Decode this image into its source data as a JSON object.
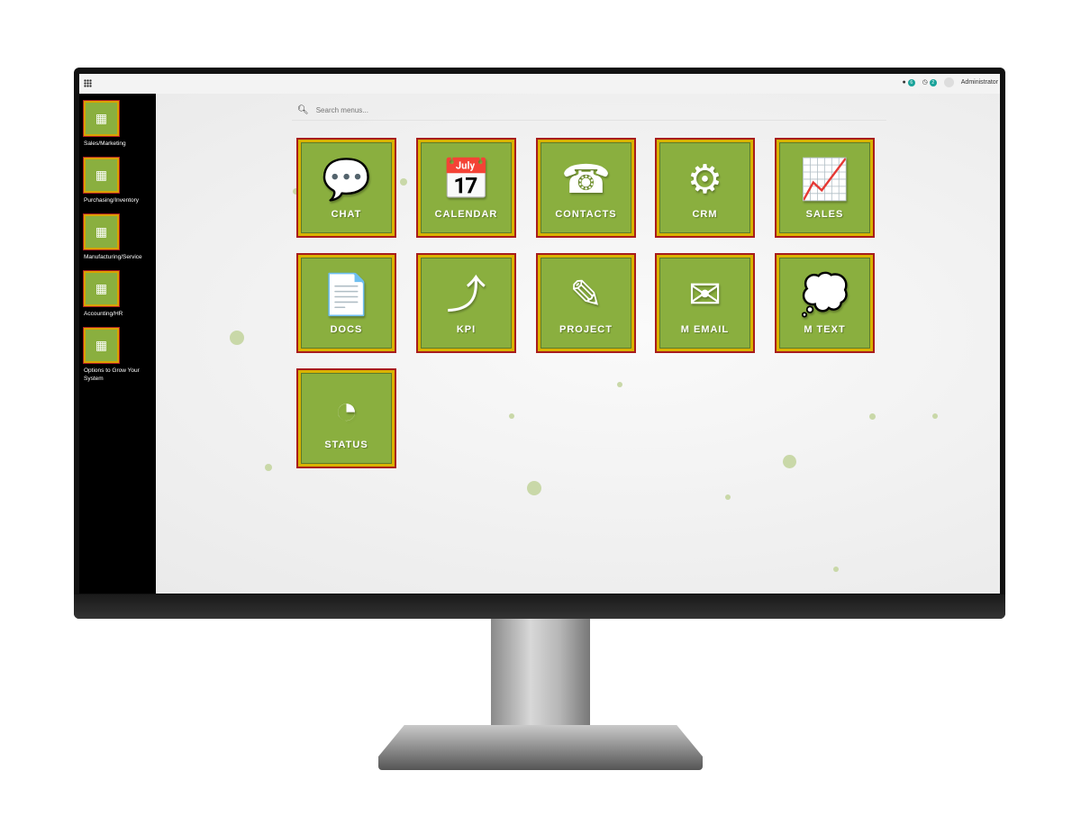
{
  "topbar": {
    "apps_icon": "grid-icon",
    "notif_count": "6",
    "activity_count": "2",
    "user": "Administrator"
  },
  "search": {
    "placeholder": "Search menus..."
  },
  "sidebar": {
    "items": [
      {
        "label": "Sales/Marketing",
        "icon": "chart-icon"
      },
      {
        "label": "Purchasing/Inventory",
        "icon": "clipboard-icon"
      },
      {
        "label": "Manufacturing/Service",
        "icon": "gear-hands-icon"
      },
      {
        "label": "Accounting/HR",
        "icon": "org-chart-icon"
      },
      {
        "label": "Options to Grow Your System",
        "icon": "plugin-icon"
      }
    ]
  },
  "tiles": [
    {
      "label": "CHAT",
      "glyph": "💬"
    },
    {
      "label": "CALENDAR",
      "glyph": "📅"
    },
    {
      "label": "CONTACTS",
      "glyph": "☎"
    },
    {
      "label": "CRM",
      "glyph": "⚙"
    },
    {
      "label": "SALES",
      "glyph": "📈"
    },
    {
      "label": "DOCS",
      "glyph": "📄"
    },
    {
      "label": "KPI",
      "glyph": "⤴"
    },
    {
      "label": "PROJECT",
      "glyph": "✎"
    },
    {
      "label": "M EMAIL",
      "glyph": "✉"
    },
    {
      "label": "M TEXT",
      "glyph": "💭"
    },
    {
      "label": "STATUS",
      "glyph": "◔"
    }
  ],
  "colors": {
    "tile": "#8aaf3f",
    "tile_border": "#a81c1c",
    "tile_inner_border": "#d9b300",
    "sidebar": "#000000"
  }
}
